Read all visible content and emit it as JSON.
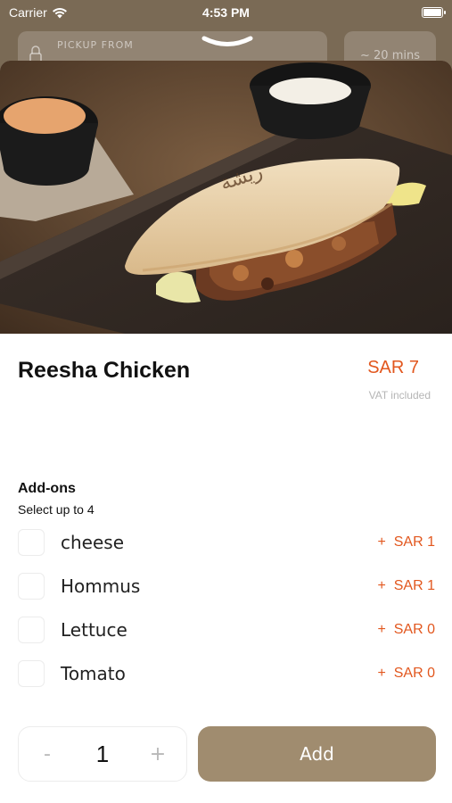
{
  "status_bar": {
    "carrier": "Carrier",
    "time": "4:53 PM"
  },
  "background": {
    "pickup_label": "PICKUP FROM",
    "eta": "~ 20 mins"
  },
  "product": {
    "name": "Reesha Chicken",
    "price": "SAR 7",
    "vat_note": "VAT included"
  },
  "addons": {
    "title": "Add-ons",
    "subtitle": "Select up to 4",
    "items": [
      {
        "name": "cheese",
        "price": "+  SAR 1"
      },
      {
        "name": "Hommus",
        "price": "+  SAR 1"
      },
      {
        "name": "Lettuce",
        "price": "+  SAR 0"
      },
      {
        "name": "Tomato",
        "price": "+  SAR 0"
      }
    ]
  },
  "cart": {
    "minus": "-",
    "quantity": "1",
    "plus": "+",
    "add_label": "Add"
  },
  "colors": {
    "accent": "#e2571e",
    "add_button": "#a08c6f"
  }
}
